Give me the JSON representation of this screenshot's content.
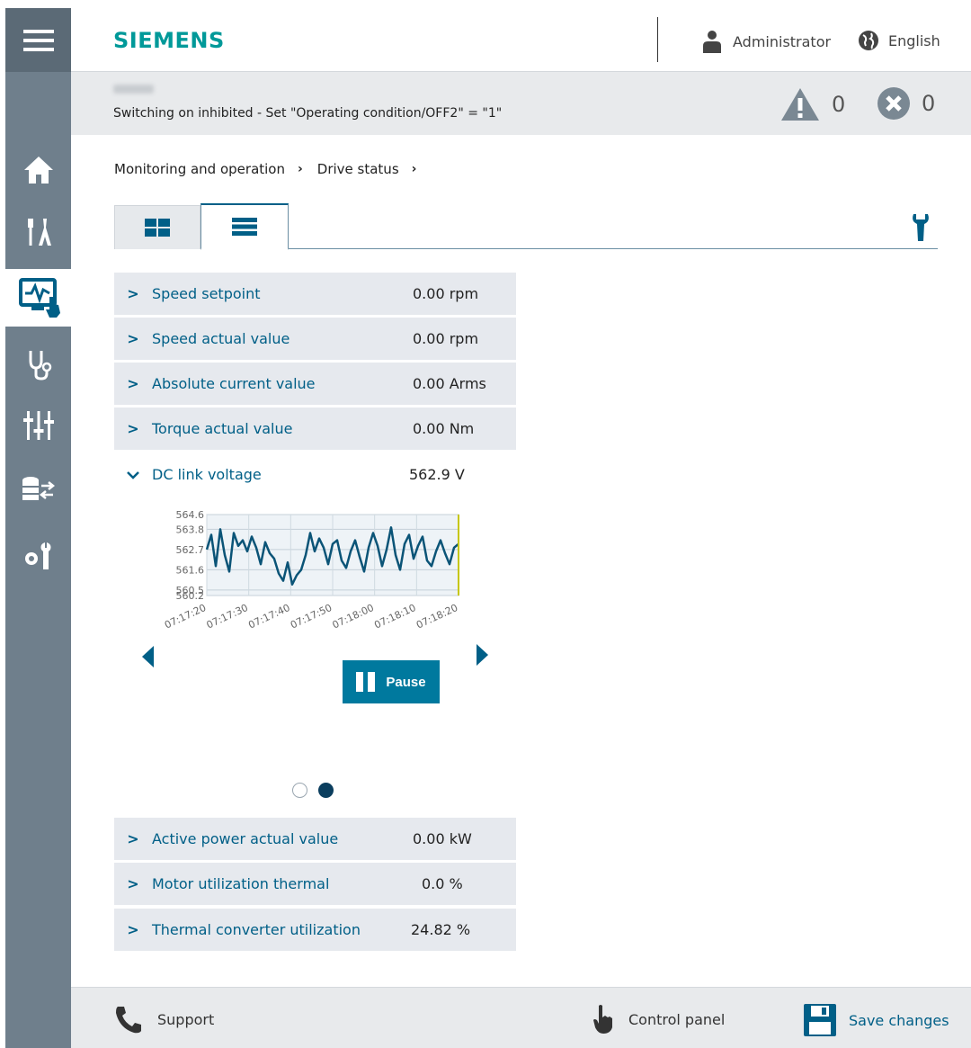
{
  "brand": "SIEMENS",
  "colors": {
    "brand": "#009999",
    "accent": "#005f87",
    "sidebar": "#6f7f8c",
    "row_bg": "#e6e9ee",
    "chart_line": "#0b5477"
  },
  "sidebar": {
    "menu_icon": "hamburger-icon",
    "items": [
      {
        "icon": "home-icon"
      },
      {
        "icon": "commissioning-tools-icon"
      },
      {
        "icon": "monitoring-icon",
        "active": true
      },
      {
        "icon": "diagnostics-stethoscope-icon"
      },
      {
        "icon": "parameters-sliders-icon"
      },
      {
        "icon": "backup-restore-icon"
      },
      {
        "icon": "system-settings-icon"
      }
    ]
  },
  "header": {
    "user": "Administrator",
    "language": "English"
  },
  "status": {
    "message": "Switching on inhibited - Set \"Operating condition/OFF2\" = \"1\"",
    "warnings": "0",
    "errors": "0"
  },
  "breadcrumb": [
    "Monitoring and operation",
    "Drive status"
  ],
  "rows_top": [
    {
      "label": "Speed setpoint",
      "value": "0.00 rpm"
    },
    {
      "label": "Speed actual value",
      "value": "0.00 rpm"
    },
    {
      "label": "Absolute current value",
      "value": "0.00 Arms"
    },
    {
      "label": "Torque actual value",
      "value": "0.00 Nm"
    }
  ],
  "expanded_row": {
    "label": "DC link voltage",
    "value": "562.9 V"
  },
  "rows_bottom": [
    {
      "label": "Active power actual value",
      "value": "0.00 kW"
    },
    {
      "label": "Motor utilization thermal",
      "value": "0.0 %"
    },
    {
      "label": "Thermal converter utilization",
      "value": "24.82 %"
    }
  ],
  "pause_label": "Pause",
  "footer": {
    "support": "Support",
    "control_panel": "Control panel",
    "save": "Save changes"
  },
  "chart_data": {
    "type": "line",
    "title": "",
    "xlabel": "",
    "ylabel": "",
    "y_ticks": [
      "564.6",
      "563.8",
      "562.7",
      "561.6",
      "560.5",
      "560.2"
    ],
    "x_ticks": [
      "07:17:20",
      "07:17:30",
      "07:17:40",
      "07:17:50",
      "07:18:00",
      "07:18:10",
      "07:18:20"
    ],
    "ylim": [
      560.2,
      564.6
    ],
    "values": [
      562.7,
      563.5,
      561.8,
      563.8,
      562.4,
      561.5,
      563.6,
      562.9,
      563.2,
      562.6,
      563.4,
      562.8,
      561.9,
      563.1,
      562.5,
      562.2,
      561.4,
      561.0,
      562.0,
      560.8,
      561.3,
      561.6,
      562.4,
      563.6,
      562.6,
      563.3,
      562.8,
      561.9,
      563.0,
      563.2,
      562.1,
      561.7,
      562.6,
      563.2,
      562.3,
      561.5,
      562.8,
      563.6,
      562.9,
      561.8,
      562.7,
      563.9,
      562.4,
      561.6,
      563.0,
      563.5,
      562.2,
      562.9,
      563.4,
      562.1,
      561.8,
      562.6,
      563.2,
      562.5,
      561.9,
      562.8,
      563.0
    ]
  }
}
